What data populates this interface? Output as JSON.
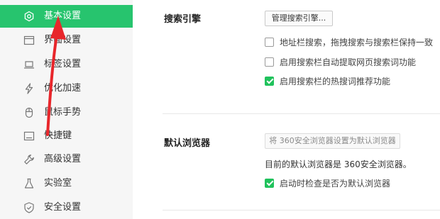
{
  "sidebar": {
    "items": [
      {
        "label": "基本设置",
        "icon": "gear-icon",
        "active": true
      },
      {
        "label": "界面设置",
        "icon": "window-icon",
        "active": false
      },
      {
        "label": "标签设置",
        "icon": "tab-icon",
        "active": false
      },
      {
        "label": "优化加速",
        "icon": "lightning-icon",
        "active": false
      },
      {
        "label": "鼠标手势",
        "icon": "mouse-icon",
        "active": false
      },
      {
        "label": "快捷键",
        "icon": "keyboard-icon",
        "active": false
      },
      {
        "label": "高级设置",
        "icon": "wrench-icon",
        "active": false
      },
      {
        "label": "实验室",
        "icon": "flask-icon",
        "active": false
      },
      {
        "label": "安全设置",
        "icon": "shield-icon",
        "active": false
      }
    ]
  },
  "search_engine": {
    "title": "搜索引擎",
    "manage_button": "管理搜索引擎...",
    "options": [
      {
        "label": "地址栏搜索，拖拽搜索与搜索栏保持一致",
        "checked": false
      },
      {
        "label": "启用搜索栏自动提取网页搜索词功能",
        "checked": false
      },
      {
        "label": "启用搜索栏的热搜词推荐功能",
        "checked": true
      }
    ]
  },
  "default_browser": {
    "title": "默认浏览器",
    "set_default_button": "将 360安全浏览器设置为默认浏览器",
    "status_text": "目前的默认浏览器是 360安全浏览器。",
    "startup_check_label": "启动时检查是否为默认浏览器",
    "startup_check_checked": true
  },
  "colors": {
    "accent": "#27c46e",
    "checkbox_checked": "#20c25c",
    "annotation_arrow": "#e8262b"
  }
}
